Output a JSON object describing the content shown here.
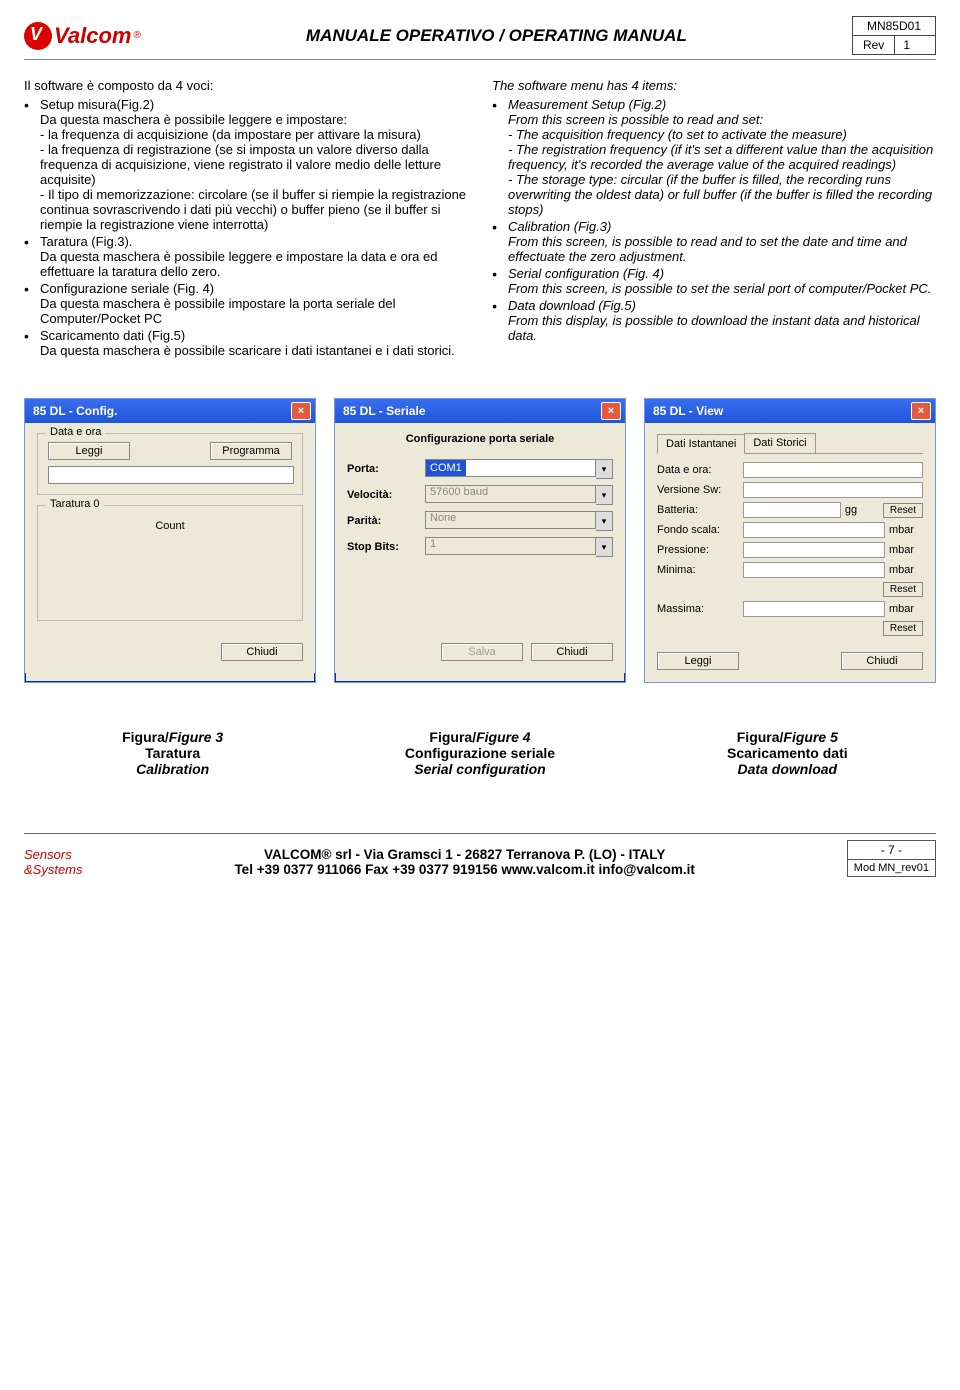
{
  "header": {
    "logo_alt": "Valcom",
    "title": "MANUALE OPERATIVO / OPERATING MANUAL",
    "doc_id": "MN85D01",
    "rev_label": "Rev",
    "rev_num": "1"
  },
  "left_col": {
    "intro": "Il software è composto da 4 voci:",
    "items": [
      {
        "title": "Setup misura(Fig.2)",
        "body": "Da questa maschera è possibile leggere e impostare:\n- la frequenza di acquisizione (da impostare per attivare la misura)\n- la frequenza di registrazione (se si imposta un valore diverso dalla frequenza di acquisizione, viene registrato il valore medio delle letture acquisite)\n- Il tipo di memorizzazione: circolare (se il buffer si riempie la registrazione continua sovrascrivendo i dati più vecchi) o buffer pieno (se il buffer si riempie la registrazione viene interrotta)"
      },
      {
        "title": "Taratura (Fig.3).",
        "body": "Da questa maschera è possibile leggere e impostare la data e ora ed effettuare la taratura dello zero."
      },
      {
        "title": "Configurazione seriale (Fig. 4)",
        "body": "Da questa maschera è possibile impostare la porta seriale del Computer/Pocket PC"
      },
      {
        "title": "Scaricamento dati (Fig.5)",
        "body": "Da questa maschera è possibile scaricare i dati istantanei e i dati storici."
      }
    ]
  },
  "right_col": {
    "intro": "The software menu has 4 items:",
    "items": [
      {
        "title": "Measurement Setup (Fig.2)",
        "body": "From this screen is possible to read and set:\n- The acquisition frequency (to set to activate the measure)\n- The registration frequency (if it's set a different value than the acquisition frequency, it's recorded the average value of the acquired readings)\n- The storage type: circular (if the buffer is filled, the recording runs overwriting the oldest data) or full buffer (if the buffer is filled the recording stops)"
      },
      {
        "title": "Calibration (Fig.3)",
        "body": "From this screen, is possible to read and to set the date and time and effectuate the zero adjustment."
      },
      {
        "title": "Serial configuration (Fig. 4)",
        "body": "From this screen, is possible to set the serial port of computer/Pocket PC."
      },
      {
        "title": "Data download (Fig.5)",
        "body": "From this display, is possible to download the instant data and historical data."
      }
    ]
  },
  "win1": {
    "title": "85 DL - Config.",
    "group1": "Data e ora",
    "btn_leggi": "Leggi",
    "btn_programma": "Programma",
    "group2": "Taratura 0",
    "count": "Count",
    "btn_chiudi": "Chiudi"
  },
  "win2": {
    "title": "85 DL - Seriale",
    "heading": "Configurazione porta seriale",
    "porta": "Porta:",
    "porta_val": "COM1",
    "velocita": "Velocità:",
    "velocita_val": "57600 baud",
    "parita": "Parità:",
    "parita_val": "None",
    "stopbits": "Stop Bits:",
    "stopbits_val": "1",
    "btn_salva": "Salva",
    "btn_chiudi": "Chiudi"
  },
  "win3": {
    "title": "85 DL - View",
    "tab1": "Dati Istantanei",
    "tab2": "Dati Storici",
    "dataora": "Data e ora:",
    "versione": "Versione Sw:",
    "batteria": "Batteria:",
    "unit_gg": "gg",
    "fondoscala": "Fondo scala:",
    "pressione": "Pressione:",
    "minima": "Minima:",
    "massima": "Massima:",
    "unit_mbar": "mbar",
    "btn_reset": "Reset",
    "btn_leggi": "Leggi",
    "btn_chiudi": "Chiudi"
  },
  "captions": {
    "c1_t": "Figura/Figure 3",
    "c1_it": "Taratura",
    "c1_en": "Calibration",
    "c2_t": "Figura/Figure 4",
    "c2_it": "Configurazione seriale",
    "c2_en": "Serial configuration",
    "c3_t": "Figura/Figure 5",
    "c3_it": "Scaricamento dati",
    "c3_en": "Data download"
  },
  "footer": {
    "sensors": "Sensors\n&Systems",
    "line1": "VALCOM® srl - Via Gramsci 1 - 26827 Terranova P. (LO) - ITALY",
    "line2": "Tel +39 0377 911066  Fax +39 0377 919156  www.valcom.it  info@valcom.it",
    "page": "- 7 -",
    "mod": "Mod MN_rev01"
  }
}
